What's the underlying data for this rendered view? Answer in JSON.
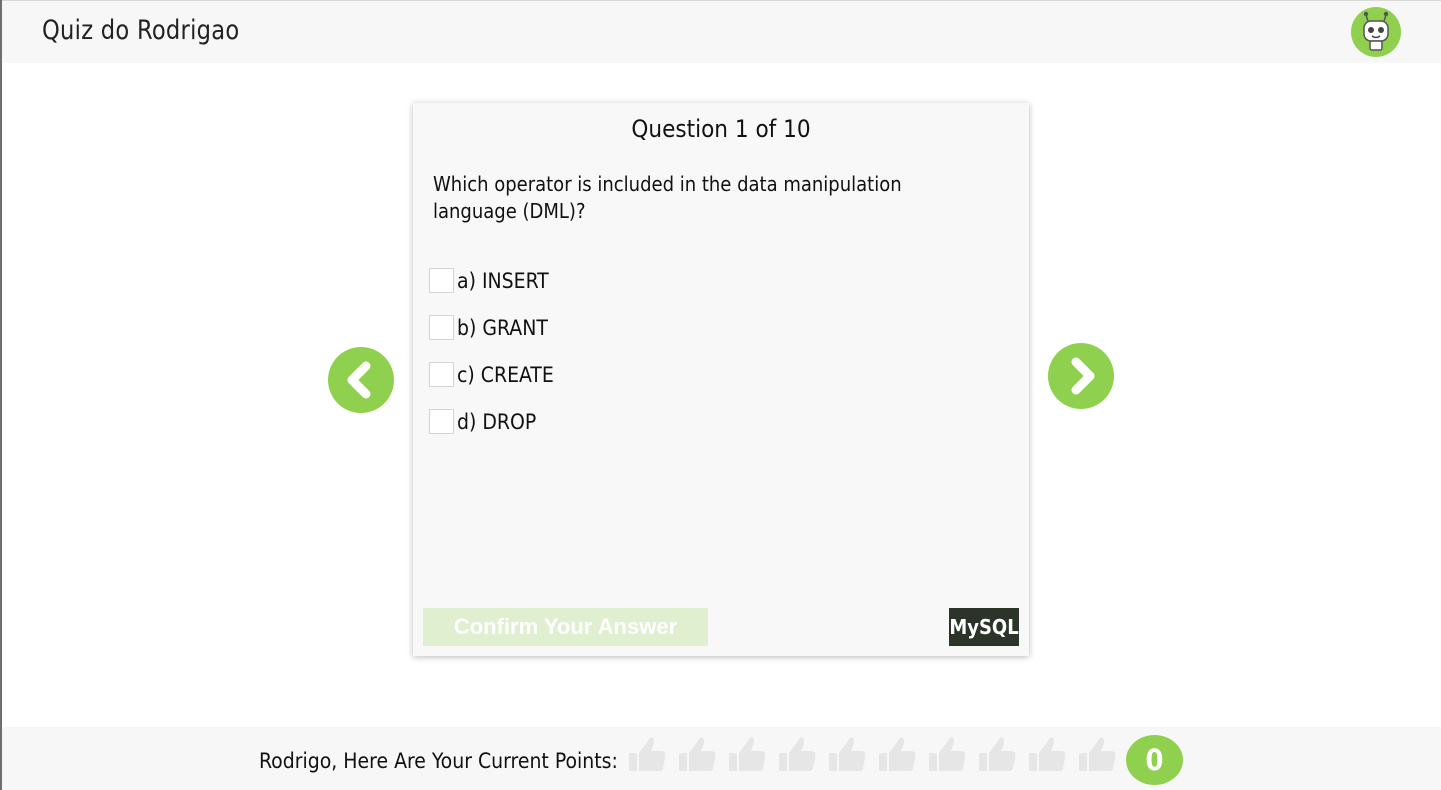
{
  "header": {
    "title": "Quiz do Rodrigao"
  },
  "avatar": {
    "icon": "robot-icon",
    "color": "#8fd14f"
  },
  "navigation": {
    "prev_icon": "chevron-left-icon",
    "next_icon": "chevron-right-icon",
    "color": "#8fd14f"
  },
  "question": {
    "counter": "Question 1 of 10",
    "text": "Which operator is included in the data manipulation language (DML)?",
    "options": [
      {
        "label": "a) INSERT",
        "checked": false
      },
      {
        "label": "b) GRANT",
        "checked": false
      },
      {
        "label": "c) CREATE",
        "checked": false
      },
      {
        "label": "d) DROP",
        "checked": false
      }
    ],
    "confirm_label": "Confirm Your Answer",
    "topic_tag": "MySQL"
  },
  "footer": {
    "points_label": "Rodrigo, Here Are Your Current Points:",
    "thumbs_count": 10,
    "thumbs_earned": 0,
    "thumb_icon": "thumbs-up-icon",
    "score": "0"
  },
  "colors": {
    "accent": "#8fd14f",
    "confirm_disabled_bg": "#e0efcf",
    "tag_bg": "#2c3329",
    "thumb_inactive": "#e6e6e6"
  }
}
